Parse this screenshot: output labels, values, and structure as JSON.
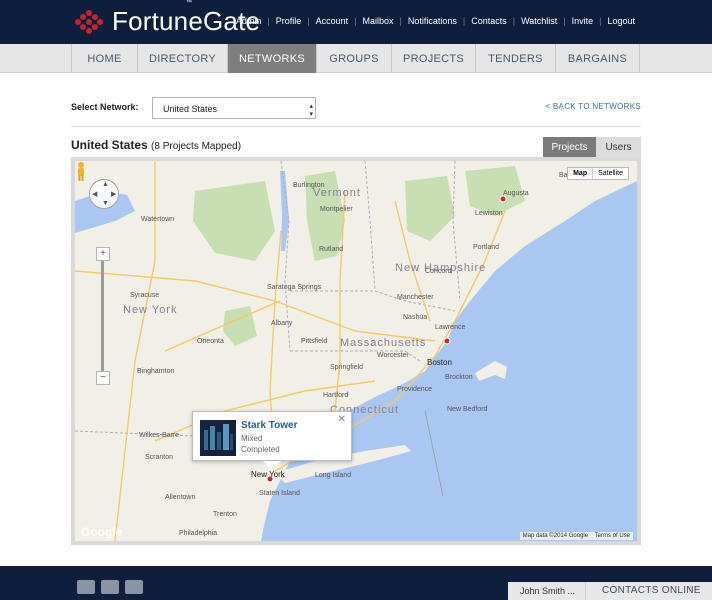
{
  "brand": {
    "name": "FortuneGate",
    "tm": "™",
    "logo_color": "#c4242b"
  },
  "toplinks": [
    "Admin",
    "Profile",
    "Account",
    "Mailbox",
    "Notifications",
    "Contacts",
    "Watchlist",
    "Invite",
    "Logout"
  ],
  "nav": {
    "items": [
      "HOME",
      "DIRECTORY",
      "NETWORKS",
      "GROUPS",
      "PROJECTS",
      "TENDERS",
      "BARGAINS"
    ],
    "active": "NETWORKS"
  },
  "selector": {
    "label": "Select Network:",
    "value": "United States",
    "back_link": "< BACK TO NETWORKS"
  },
  "map_header": {
    "title": "United States",
    "subtitle": "(8 Projects Mapped)"
  },
  "view_toggle": {
    "projects": "Projects",
    "users": "Users",
    "active": "Projects"
  },
  "map": {
    "type_buttons": [
      "Map",
      "Satellite"
    ],
    "attribution": "Map data ©2014 Google",
    "terms": "Terms of Use",
    "google_logo": "Google",
    "labels": [
      {
        "text": "Vermont"
      },
      {
        "text": "New Hampshire"
      },
      {
        "text": "New York"
      },
      {
        "text": "Massachusetts"
      },
      {
        "text": "Connecticut"
      },
      {
        "text": "Montpelier"
      },
      {
        "text": "Burlington"
      },
      {
        "text": "Rutland"
      },
      {
        "text": "Concord"
      },
      {
        "text": "Manchester"
      },
      {
        "text": "Nashua"
      },
      {
        "text": "Lawrence"
      },
      {
        "text": "Boston"
      },
      {
        "text": "Worcester"
      },
      {
        "text": "Springfield"
      },
      {
        "text": "Hartford"
      },
      {
        "text": "Providence"
      },
      {
        "text": "Albany"
      },
      {
        "text": "Syracuse"
      },
      {
        "text": "Binghamton"
      },
      {
        "text": "Portland"
      },
      {
        "text": "Augusta"
      },
      {
        "text": "Lewiston"
      },
      {
        "text": "New York"
      },
      {
        "text": "Staten Island"
      },
      {
        "text": "Long Island"
      },
      {
        "text": "Philadelphia"
      },
      {
        "text": "Allentown"
      },
      {
        "text": "Trenton"
      },
      {
        "text": "Scranton"
      },
      {
        "text": "Wilkes-Barre"
      },
      {
        "text": "New Bedford"
      },
      {
        "text": "Pittsfield"
      },
      {
        "text": "Brockton"
      },
      {
        "text": "Bangor"
      },
      {
        "text": "Watertown"
      },
      {
        "text": "Oneonta"
      },
      {
        "text": "Saratoga Springs"
      }
    ],
    "markers": [
      {
        "name": "Augusta",
        "color": "#d8232a"
      },
      {
        "name": "Lawrence",
        "color": "#d8232a"
      },
      {
        "name": "New York",
        "color": "#d8232a"
      }
    ]
  },
  "infowindow": {
    "title": "Stark Tower",
    "type": "Mixed",
    "status": "Completed"
  },
  "chat": {
    "user": "John Smith ...",
    "online": "CONTACTS ONLINE"
  }
}
